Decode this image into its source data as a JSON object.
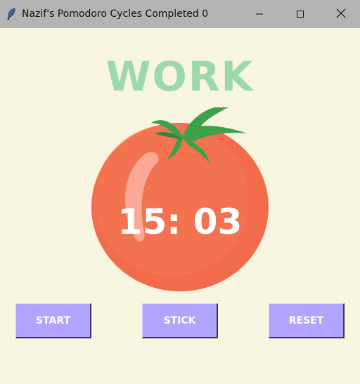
{
  "window": {
    "title": "Nazif's Pomodoro Cycles Completed 0"
  },
  "timer": {
    "mode_label": "WORK",
    "display": "15: 03"
  },
  "buttons": {
    "start_label": "START",
    "stick_label": "STICK",
    "reset_label": "RESET"
  },
  "colors": {
    "background": "#f7f5df",
    "mode_label": "#9bd9a8",
    "tomato": "#f26b4b",
    "button": "#b1a4ff",
    "button_text": "#ffffff"
  },
  "icons": {
    "app": "feather-icon",
    "minimize": "minimize-icon",
    "maximize": "maximize-icon",
    "close": "close-icon"
  }
}
